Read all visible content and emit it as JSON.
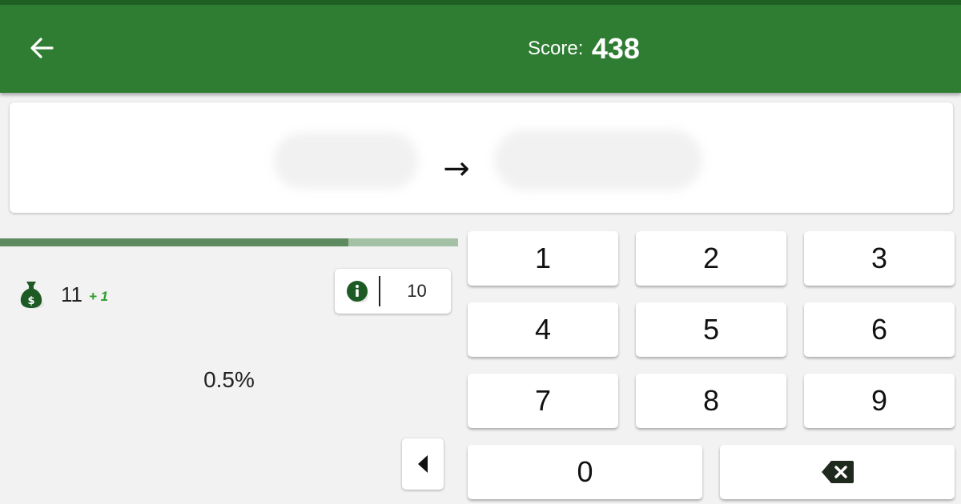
{
  "header": {
    "score_label": "Score:",
    "score_value": "438"
  },
  "question": {
    "arrow": "→"
  },
  "progress": {
    "fraction": 0.76
  },
  "stats": {
    "coins": "11",
    "coins_bonus": "+ 1",
    "info_value": "10",
    "percent": "0.5%"
  },
  "keypad": {
    "k1": "1",
    "k2": "2",
    "k3": "3",
    "k4": "4",
    "k5": "5",
    "k6": "6",
    "k7": "7",
    "k8": "8",
    "k9": "9",
    "k0": "0"
  },
  "icons": {
    "back": "arrow-left-icon",
    "coins": "money-bag-icon",
    "info": "info-icon",
    "prev": "triangle-left-icon",
    "backspace": "backspace-icon"
  },
  "colors": {
    "app_bar": "#2e7d32",
    "progress_fill": "#5d8a5e",
    "progress_track": "#a5c1a5",
    "bonus": "#2e9e2e",
    "icon_dark": "#1e5a24"
  }
}
